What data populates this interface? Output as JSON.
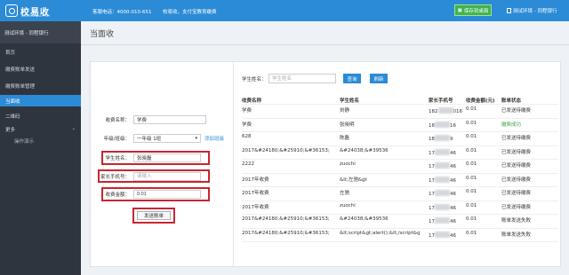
{
  "topbar": {
    "logo_text": "校易收",
    "logo_sub": "SCHOOL EASY PAY",
    "hotline": "客服电话：4000-010-651",
    "notice": "校易收，支付宝教育缴费",
    "action_button": "保存到桌面",
    "user": "测试环境 - 同程银行"
  },
  "sidebar": {
    "header": "测试环境 - 同程银行",
    "items": [
      {
        "label": "首页",
        "active": false
      },
      {
        "label": "缴费账单发送",
        "active": false
      },
      {
        "label": "缴费账单管理",
        "active": false
      },
      {
        "label": "当面收",
        "active": true
      },
      {
        "label": "二维码",
        "active": false
      },
      {
        "label": "更多",
        "active": false
      },
      {
        "label": "操作演示",
        "active": false,
        "sub": true
      }
    ]
  },
  "page": {
    "title": "当面收"
  },
  "form": {
    "fee_name_label": "收费名称：",
    "fee_name_value": "学费",
    "grade_label": "年级/班级：",
    "grade_value": "一年级 1班",
    "grade_link": "添加班级",
    "student_label": "学生姓名：",
    "student_value": "张晓磊",
    "phone_label": "家长手机号：",
    "phone_placeholder": "请输入",
    "amount_label": "收费金额：",
    "amount_value": "0.01",
    "send_button": "发送账单"
  },
  "search": {
    "label": "学生姓名：",
    "placeholder": "学生姓名",
    "query_button": "查询",
    "refresh_button": "刷新"
  },
  "table": {
    "headers": [
      "收费名称",
      "学生姓名",
      "家长手机号",
      "收费金额(元)",
      "账单状态"
    ],
    "rows": [
      {
        "name": "学费",
        "student": "刘静",
        "phone_prefix": "182",
        "phone_suffix": "016",
        "amount": "0.01",
        "status": "已发送待缴费",
        "ok": false
      },
      {
        "name": "学费",
        "student": "张晓明",
        "phone_prefix": "18",
        "phone_suffix": "16",
        "amount": "0.01",
        "status": "缴费成功",
        "ok": true
      },
      {
        "name": "628",
        "student": "陈磊",
        "phone_prefix": "18",
        "phone_suffix": "9",
        "amount": "0.01",
        "status": "已发送待缴费",
        "ok": false
      },
      {
        "name": "2017&#24180;&#25910;&#36153;",
        "student": "&#24038;&#39536",
        "phone_prefix": "17",
        "phone_suffix": "46",
        "amount": "0.01",
        "status": "已发送待缴费",
        "ok": false
      },
      {
        "name": "2222",
        "student": "zuochi",
        "phone_prefix": "17",
        "phone_suffix": "46",
        "amount": "0.01",
        "status": "已发送待缴费",
        "ok": false
      },
      {
        "name": "2017年收费",
        "student": "&lt;左驰&gt",
        "phone_prefix": "17",
        "phone_suffix": "46",
        "amount": "0.01",
        "status": "已发送待缴费",
        "ok": false
      },
      {
        "name": "2017年收费",
        "student": "左驰",
        "phone_prefix": "17",
        "phone_suffix": "46",
        "amount": "0.01",
        "status": "已发送待缴费",
        "ok": false
      },
      {
        "name": "2017年收费",
        "student": "zuochi",
        "phone_prefix": "17",
        "phone_suffix": "46",
        "amount": "0.01",
        "status": "已发送待缴费",
        "ok": false
      },
      {
        "name": "2017&#24180;&#25910;&#36153;",
        "student": "&#24038;&#39536",
        "phone_prefix": "17",
        "phone_suffix": "46",
        "amount": "0.01",
        "status": "账单发送失败",
        "ok": false
      },
      {
        "name": "2017&#24180;&#25910;&#36153;",
        "student": "&lt;script&gt;alert();&lt;/script&gt",
        "phone_prefix": "17",
        "phone_suffix": "46",
        "amount": "0.01",
        "status": "账单发送失败",
        "ok": false
      }
    ]
  },
  "colors": {
    "primary": "#2b8bd6",
    "sidebar_bg": "#2f353e",
    "highlight_box": "#c9252f",
    "success_text": "#3aa349",
    "action_button_bg": "#3fb34f"
  },
  "icons": [
    "logo-icon",
    "desktop-icon",
    "user-icon",
    "chevron-down-icon",
    "select-caret-icon"
  ]
}
